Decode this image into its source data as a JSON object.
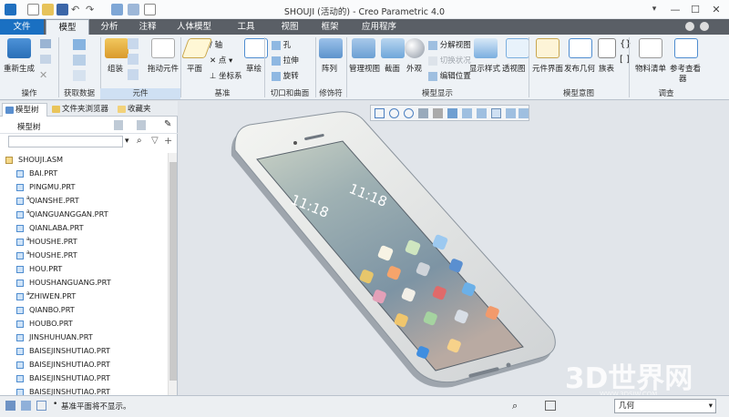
{
  "window": {
    "title": "SHOUJI (活动的) - Creo Parametric 4.0",
    "minimize": "—",
    "maximize": "☐",
    "close": "✕"
  },
  "tabs": [
    {
      "label": "文件",
      "active": false
    },
    {
      "label": "模型",
      "active": true
    },
    {
      "label": "分析"
    },
    {
      "label": "注释"
    },
    {
      "label": "人体模型"
    },
    {
      "label": "工具"
    },
    {
      "label": "视图"
    },
    {
      "label": "框架"
    },
    {
      "label": "应用程序"
    }
  ],
  "ribbon": {
    "regen": "重新生成",
    "ops_group": "操作",
    "getdata_group": "获取数据",
    "assemble": "组装",
    "drag": "拖动元件",
    "component_group": "元件",
    "plane": "平面",
    "axis": "轴",
    "point": "点",
    "csys": "坐标系",
    "sketch": "草绘",
    "datum_group": "基准",
    "hole": "孔",
    "extrude": "拉伸",
    "revolve": "旋转",
    "cut_group": "切口和曲面",
    "pattern": "阵列",
    "modifier_group": "修饰符",
    "manage_views": "管理视图",
    "section": "截面",
    "appearance": "外观",
    "explode": "分解视图",
    "toggle_status": "切换状况",
    "edit_position": "编辑位置",
    "display_style": "显示样式",
    "perspective": "透视图",
    "model_display_group": "模型显示",
    "comp_interface": "元件界面",
    "publish_geom": "发布几何",
    "table": "族表",
    "model_intent_group": "模型意图",
    "bom": "物料清单",
    "ref_viewer_1": "参考查看",
    "ref_viewer_2": "器",
    "investigate_group": "调查"
  },
  "navigator": {
    "tabs": [
      "模型树",
      "文件夹浏览器",
      "收藏夹"
    ],
    "tree_title": "模型树",
    "search_placeholder": "",
    "items": [
      {
        "name": "SHOUJI.ASM",
        "level": 0,
        "tag": ""
      },
      {
        "name": "BAI.PRT",
        "level": 1,
        "tag": ""
      },
      {
        "name": "PINGMU.PRT",
        "level": 1,
        "tag": ""
      },
      {
        "name": "QIANSHE.PRT",
        "level": 1,
        "tag": "a"
      },
      {
        "name": "QIANGUANGGAN.PRT",
        "level": 1,
        "tag": "a"
      },
      {
        "name": "QIANLABA.PRT",
        "level": 1,
        "tag": ""
      },
      {
        "name": "HOUSHE.PRT",
        "level": 1,
        "tag": "a"
      },
      {
        "name": "HOUSHE.PRT",
        "level": 1,
        "tag": "a"
      },
      {
        "name": "HOU.PRT",
        "level": 1,
        "tag": ""
      },
      {
        "name": "HOUSHANGUANG.PRT",
        "level": 1,
        "tag": ""
      },
      {
        "name": "ZHIWEN.PRT",
        "level": 1,
        "tag": "a"
      },
      {
        "name": "QIANBO.PRT",
        "level": 1,
        "tag": ""
      },
      {
        "name": "HOUBO.PRT",
        "level": 1,
        "tag": ""
      },
      {
        "name": "JINSHUHUAN.PRT",
        "level": 1,
        "tag": ""
      },
      {
        "name": "BAISEJINSHUTIAO.PRT",
        "level": 1,
        "tag": ""
      },
      {
        "name": "BAISEJINSHUTIAO.PRT",
        "level": 1,
        "tag": ""
      },
      {
        "name": "BAISEJINSHUTIAO.PRT",
        "level": 1,
        "tag": ""
      },
      {
        "name": "BAISEJINSHUTIAO.PRT",
        "level": 1,
        "tag": ""
      }
    ]
  },
  "phone": {
    "time": "11:18",
    "date": "11:18"
  },
  "status": {
    "message": "基准平面将不显示。",
    "filter_value": "几何"
  },
  "watermark": {
    "text": "3D世界网",
    "sub": "WWW.3DSJW.COM"
  },
  "colors": {
    "file_tab": "#1a70c2",
    "tab_bar": "#5a5f66",
    "ribbon_bg": "#eef2f6",
    "viewport_bg": "#e1e5ea",
    "accent": "#2c7fd3"
  }
}
